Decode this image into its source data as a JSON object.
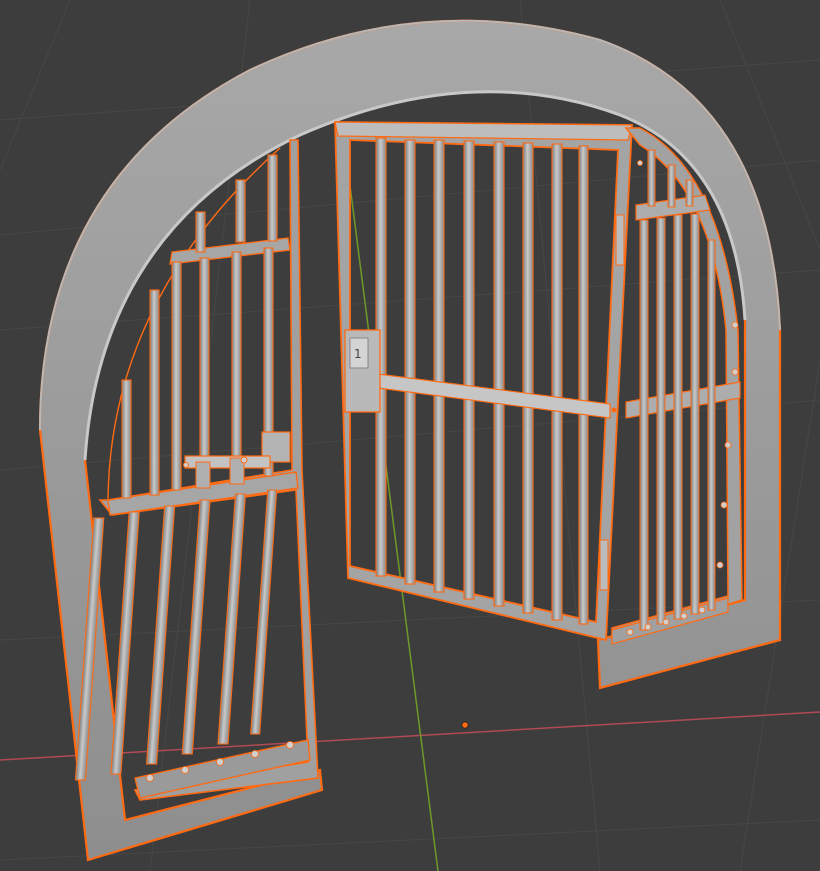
{
  "viewport": {
    "background": "#3d3d3d",
    "grid_color": "#474747",
    "x_axis_color": "#b04a55",
    "y_axis_color": "#6f9a2a",
    "origin_color": "#ff6a13"
  },
  "scene": {
    "object": "arched-prison-gate",
    "selected": true,
    "selection_outline_color": "#ff6a13",
    "material_color": "#9b9b9b",
    "bar_color": "#b5b5b5",
    "left_panel": {
      "shows": "fixed-grille-with-sliding-bolt"
    },
    "door": {
      "state": "open",
      "lock_plate_mark": "1"
    },
    "right_panel": {
      "shows": "fixed-grille"
    }
  }
}
